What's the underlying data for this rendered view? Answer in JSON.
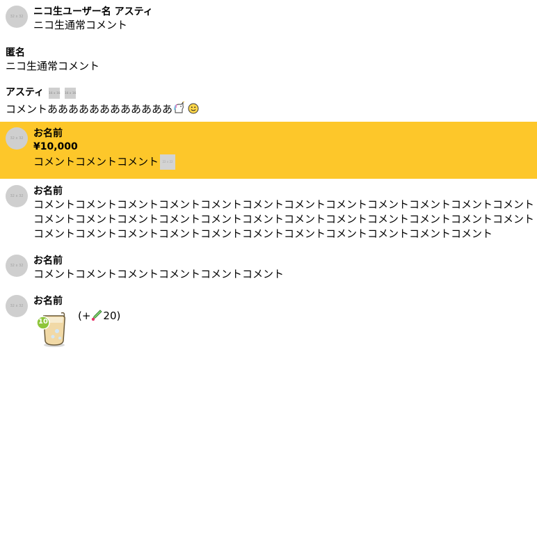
{
  "comments": [
    {
      "avatar_label": "32 x 32",
      "name": "ニコ生ユーザー名 アスティ",
      "text": "ニコ生通常コメント"
    },
    {
      "name": "匿名",
      "text": "ニコ生通常コメント"
    },
    {
      "name": "アスティ",
      "badge_label": "16 x 16",
      "text": "コメントああああああああああああ"
    },
    {
      "avatar_label": "32 x 32",
      "name": "お名前",
      "amount": "¥10,000",
      "text": "コメントコメントコメント",
      "image_label": "22 x 22",
      "highlight_color": "#fdc72a"
    },
    {
      "avatar_label": "32 x 32",
      "name": "お名前",
      "text": "コメントコメントコメントコメントコメントコメントコメントコメントコメントコメントコメントコメントコメントコメントコメントコメントコメントコメントコメントコメントコメントコメントコメントコメントコメントコメントコメントコメントコメントコメントコメントコメントコメントコメントコメント"
    },
    {
      "avatar_label": "32 x 32",
      "name": "お名前",
      "text": "コメントコメントコメントコメントコメントコメント"
    },
    {
      "avatar_label": "32 x 32",
      "name": "お名前",
      "gift_level": "10",
      "gift_points_prefix": "(+",
      "gift_points": "20)"
    }
  ],
  "icons": {
    "unicorn": "unicorn-emoji-icon",
    "smile": "smile-emoji-icon",
    "pen": "pen-point-icon",
    "gift": "gift-cup-icon"
  }
}
